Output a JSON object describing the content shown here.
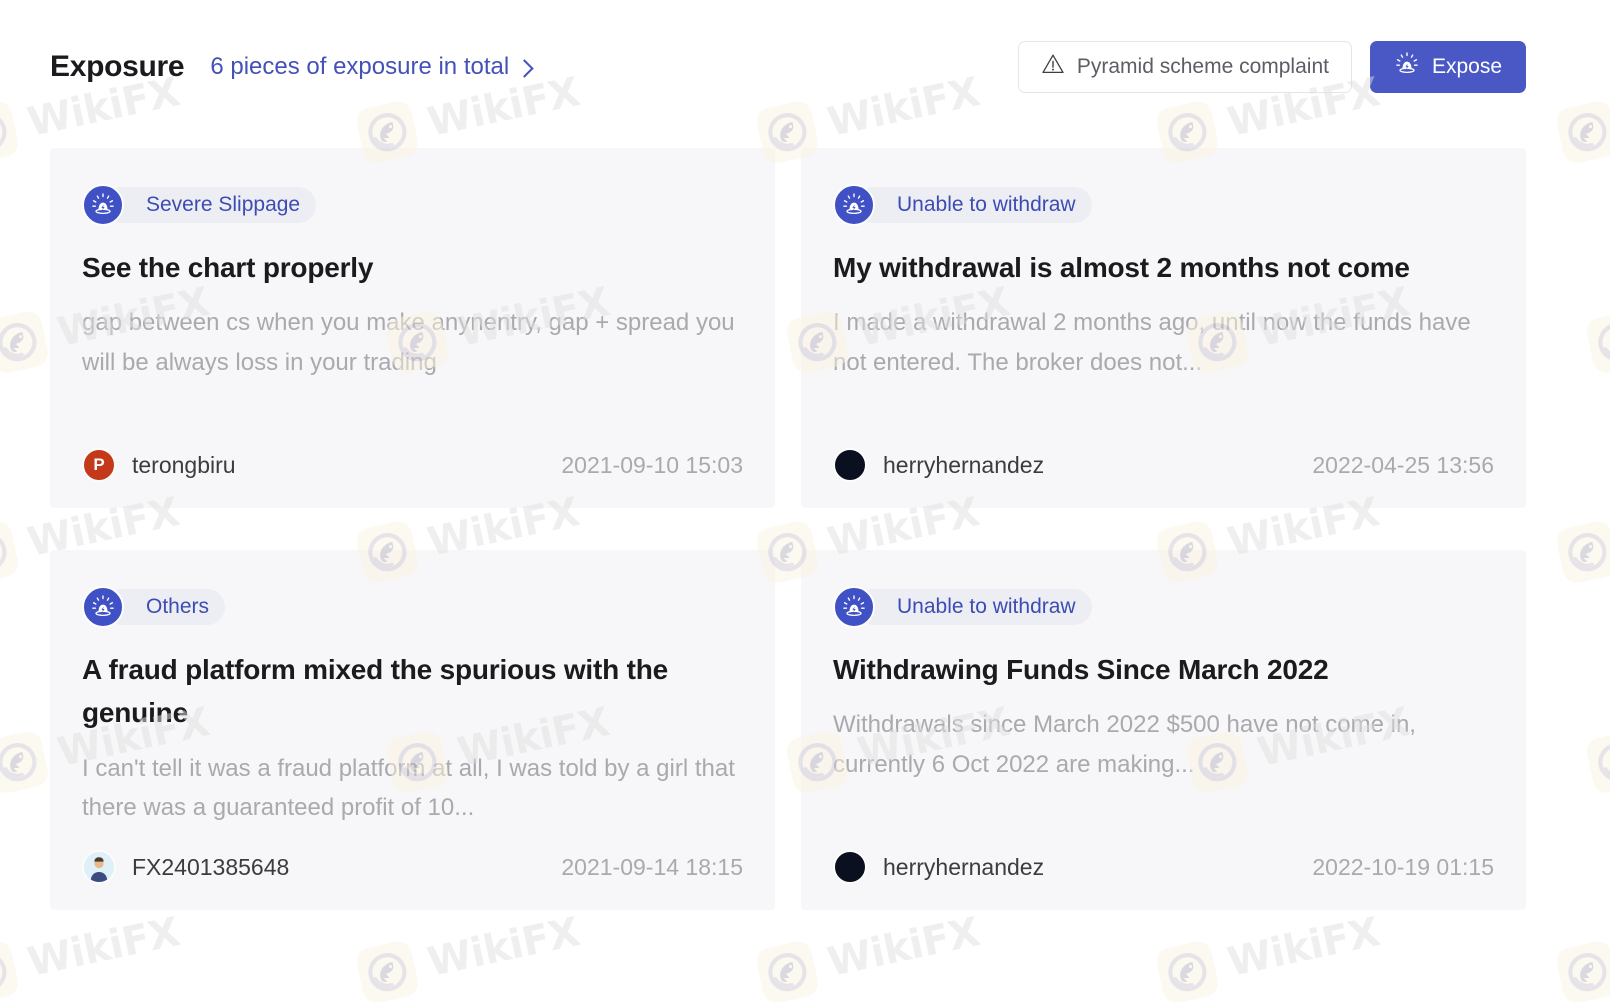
{
  "header": {
    "title": "Exposure",
    "total_link": "6 pieces of exposure in total",
    "chevron_icon": "chevron-right-icon",
    "pyramid_button": {
      "label": "Pyramid scheme complaint",
      "icon": "warning-triangle-icon"
    },
    "expose_button": {
      "label": "Expose",
      "icon": "siren-icon"
    }
  },
  "colors": {
    "accent_blue": "#4a58c6",
    "link_blue": "#4451b8",
    "badge_text": "#3d4cb3",
    "badge_bg": "#eceef3",
    "card_bg": "#f7f7f9",
    "page_bg": "#ffffff",
    "title_text": "#1b1b1f",
    "muted_text": "#a9a9ae",
    "avatar_red": "#c3391a",
    "watermark_text": "#e2e0e0",
    "watermark_logo_bg": "#fbf5e2"
  },
  "watermark": {
    "text": "WikiFX",
    "logo_icon": "wikifx-eagle-logo-icon"
  },
  "cards": [
    {
      "category": "Severe Slippage",
      "category_icon": "siren-icon",
      "title": "See the chart properly",
      "description": "gap between cs when you make anynentry, gap + spread you will be always loss in your trading",
      "user": "terongbiru",
      "avatar_type": "initial",
      "avatar_initial": "P",
      "time": "2021-09-10 15:03"
    },
    {
      "category": "Unable to withdraw",
      "category_icon": "siren-icon",
      "title": "My withdrawal is almost 2 months not come",
      "description": "I made a withdrawal 2 months ago, until now the funds have not entered. The broker does not...",
      "user": "herryhernandez",
      "avatar_type": "dark",
      "avatar_initial": "",
      "time": "2022-04-25 13:56"
    },
    {
      "category": "Others",
      "category_icon": "siren-icon",
      "title": "A fraud platform mixed the spurious with the genuine",
      "description": "I can't tell it was a fraud platform at all, I was told by a girl that there was a guaranteed profit of 10...",
      "user": "FX2401385648",
      "avatar_type": "default",
      "avatar_initial": "",
      "time": "2021-09-14 18:15"
    },
    {
      "category": "Unable to withdraw",
      "category_icon": "siren-icon",
      "title": "Withdrawing Funds Since March 2022",
      "description": "Withdrawals since March 2022 $500 have not come in, currently 6 Oct 2022 are making...",
      "user": "herryhernandez",
      "avatar_type": "dark",
      "avatar_initial": "",
      "time": "2022-10-19 01:15"
    }
  ]
}
